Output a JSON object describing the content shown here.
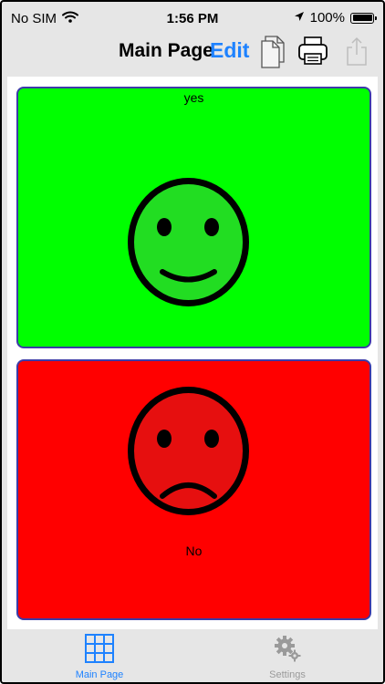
{
  "status_bar": {
    "carrier": "No SIM",
    "time": "1:56 PM",
    "battery": "100%",
    "battery_level": 1.0
  },
  "navbar": {
    "title": "Main Page",
    "edit_label": "Edit",
    "icons": [
      "document-icon",
      "print-icon",
      "share-icon"
    ]
  },
  "cards": {
    "yes": {
      "label": "yes",
      "color": "#00ff00",
      "face_color": "#22dd22"
    },
    "no": {
      "label": "No",
      "color": "#ff0000",
      "face_color": "#e60f0f"
    }
  },
  "tabbar": {
    "tabs": [
      {
        "label": "Main Page",
        "icon": "grid-icon",
        "selected": true
      },
      {
        "label": "Settings",
        "icon": "gear-icon",
        "selected": false
      }
    ]
  },
  "colors": {
    "accent": "#1e82ff",
    "inactive": "#9a9a9a",
    "card_border": "#3b3ba8"
  }
}
